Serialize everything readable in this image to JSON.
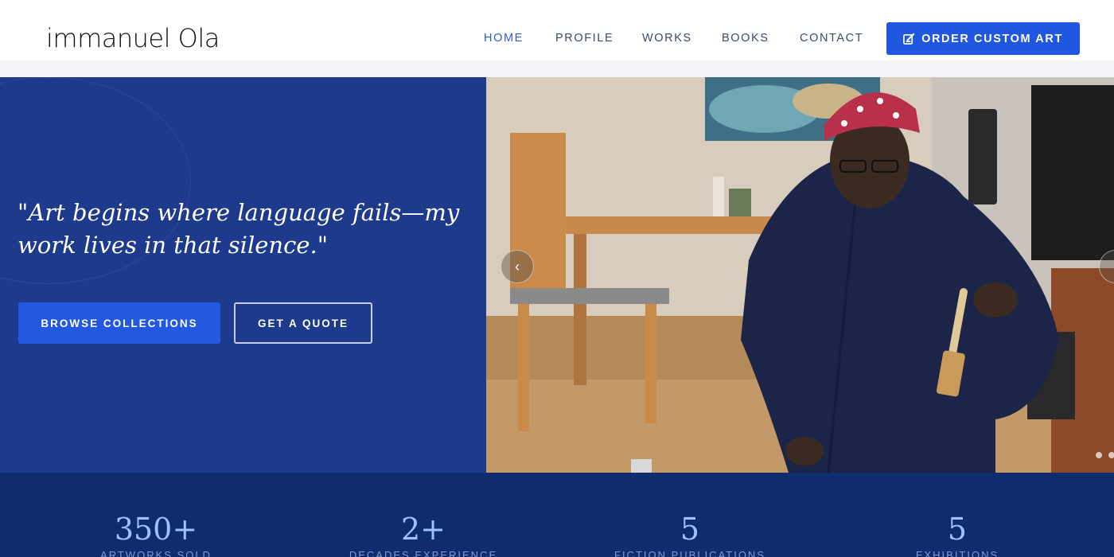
{
  "header": {
    "logo": "immanuel Ola",
    "nav": [
      {
        "label": "HOME",
        "active": true
      },
      {
        "label": "PROFILE",
        "active": false
      },
      {
        "label": "WORKS",
        "active": false
      },
      {
        "label": "BOOKS",
        "active": false
      },
      {
        "label": "CONTACT",
        "active": false
      }
    ],
    "cta_label": "ORDER CUSTOM ART",
    "cta_icon": "pen-square-icon"
  },
  "hero": {
    "quote": "\"Art begins where language fails—my work lives in that silence.\"",
    "primary_button": "BROWSE COLLECTIONS",
    "secondary_button": "GET A QUOTE",
    "prev_arrow": "‹"
  },
  "stats": [
    {
      "value": "350+",
      "label": "ARTWORKS SOLD"
    },
    {
      "value": "2+",
      "label": "DECADES EXPERIENCE"
    },
    {
      "value": "5",
      "label": "FICTION PUBLICATIONS"
    },
    {
      "value": "5",
      "label": "EXHIBITIONS"
    }
  ],
  "colors": {
    "brand_blue": "#1f57e0",
    "hero_panel": "#1d3a8c",
    "stats_bg": "#0f2c6e",
    "stat_number": "#9cc3ff"
  }
}
